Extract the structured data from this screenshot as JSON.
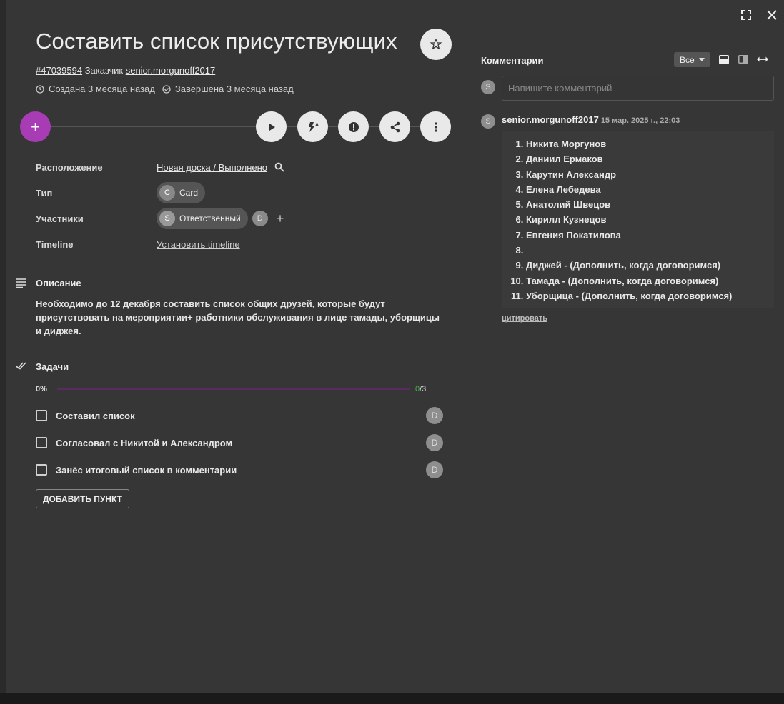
{
  "card": {
    "title": "Составить список присутствующих",
    "id_label": "#47039594",
    "customer_prefix": "Заказчик",
    "customer": "senior.morgunoff2017",
    "created": "Создана 3 месяца назад",
    "completed": "Завершена 3 месяца назад"
  },
  "actions": {
    "add": "+",
    "icons": [
      "play-icon",
      "auto-flash-icon",
      "alert-icon",
      "share-icon",
      "more-vert-icon"
    ]
  },
  "props": {
    "location_label": "Расположение",
    "location_value": "Новая доска / Выполнено",
    "type_label": "Тип",
    "type_avatar": "C",
    "type_value": "Card",
    "members_label": "Участники",
    "member_avatar": "S",
    "member_value": "Ответственный",
    "member2_avatar": "D",
    "add_member": "+",
    "timeline_label": "Timeline",
    "timeline_value": "Установить timeline"
  },
  "description": {
    "heading": "Описание",
    "text": "Необходимо до 12 декабря составить список общих друзей, которые будут присутствовать на мероприятии+ работники обслуживания в лице тамады, уборщицы и диджея."
  },
  "tasks": {
    "heading": "Задачи",
    "percent_label": "0%",
    "progress": 0,
    "done": "0",
    "total": "/3",
    "items": [
      {
        "label": "Составил список",
        "avatar": "D"
      },
      {
        "label": "Согласовал с Никитой и Александром",
        "avatar": "D"
      },
      {
        "label": "Занёс итоговый список в комментарии",
        "avatar": "D"
      }
    ],
    "add_label": "ДОБАВИТЬ ПУНКТ"
  },
  "comments": {
    "heading": "Комментарии",
    "filter": "Все",
    "input_avatar": "S",
    "placeholder": "Напишите комментарий",
    "author_avatar": "S",
    "author": "senior.morgunoff2017",
    "date": "15 мар. 2025 г., 22:03",
    "list": [
      "Никита Моргунов",
      "Даниил Ермаков",
      "Карутин Александр",
      "Елена Лебедева",
      "Анатолий Швецов",
      "Кирилл Кузнецов",
      "Евгения Покатилова",
      "",
      "Диджей - (Дополнить, когда договоримся)",
      "Тамада - (Дополнить, когда договоримся)",
      "Уборщица - (Дополнить, когда договоримся)"
    ],
    "quote": "цитировать"
  },
  "colors": {
    "accent": "#a73cb4",
    "panel": "#363636",
    "progress_track": "#5a2a60",
    "done_count": "#4caf50"
  }
}
